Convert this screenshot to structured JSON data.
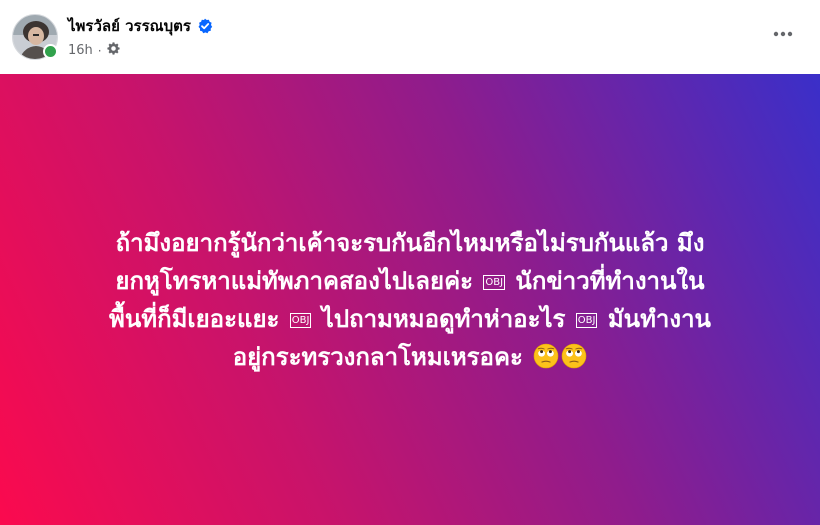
{
  "post": {
    "author": {
      "name": "ไพรวัลย์ วรรณบุตร",
      "verified_icon": "verified-badge-icon",
      "online_status_color": "#31a24c"
    },
    "meta": {
      "timestamp": "16h",
      "separator": "·",
      "privacy_icon": "public-gear-icon"
    },
    "more_options_icon": "more-options-icon",
    "content": {
      "background_gradient": [
        "#fb0a4e",
        "#c9136a",
        "#8f1c8c",
        "#3a2fc9"
      ],
      "text_color": "#ffffff",
      "lines": [
        {
          "parts": [
            {
              "text": "ถ้ามึงอยากรู้นักว่าเค้าจะรบกันอีกไหมหรือไม่รบกันแล้ว มึง"
            }
          ]
        },
        {
          "parts": [
            {
              "text": "ยกหูโทรหาแม่ทัพภาคสองไปเลยค่ะ "
            },
            {
              "obj": "OBJ"
            },
            {
              "text": " นักข่าวที่ทำงานใน"
            }
          ]
        },
        {
          "parts": [
            {
              "text": "พื้นที่ก็มีเยอะแยะ "
            },
            {
              "obj": "OBJ"
            },
            {
              "text": " ไปถามหมอดูทำห่าอะไร "
            },
            {
              "obj": "OBJ"
            },
            {
              "text": " มันทำงาน"
            }
          ]
        },
        {
          "parts": [
            {
              "text": "อยู่กระทรวงกลาโหมเหรอคะ "
            },
            {
              "emoji": "eye-roll-emoji"
            },
            {
              "emoji": "eye-roll-emoji"
            }
          ]
        }
      ]
    }
  }
}
